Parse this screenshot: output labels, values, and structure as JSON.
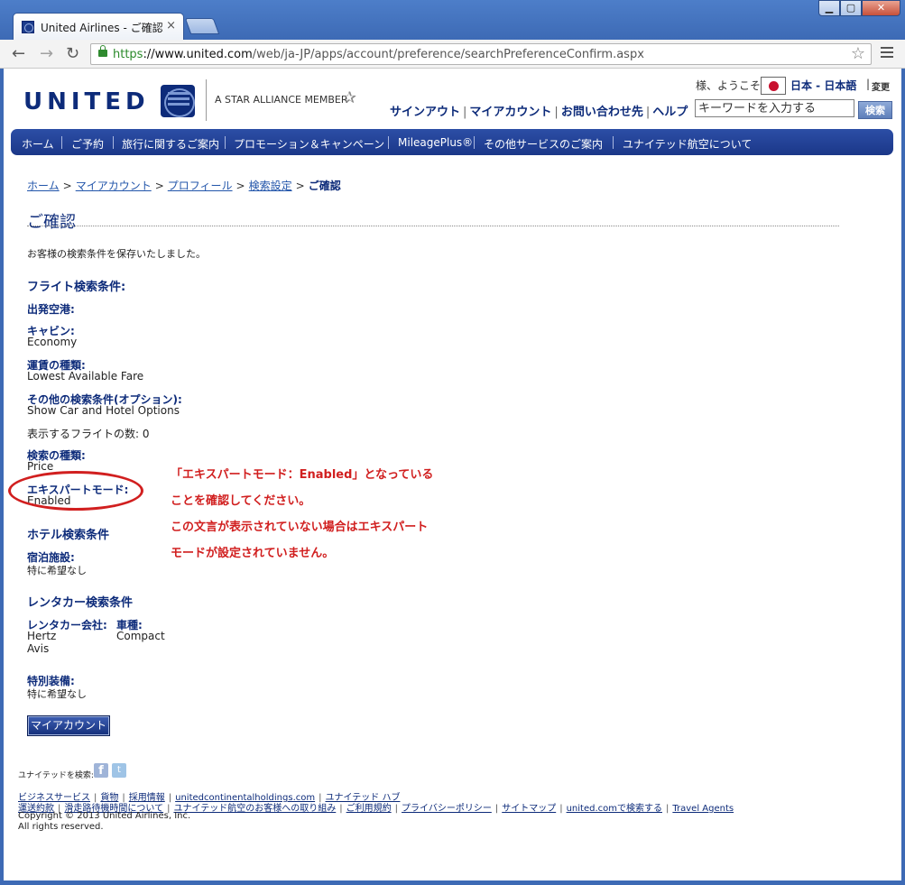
{
  "browser": {
    "tab_title": "United Airlines - ご確認",
    "url_https": "https",
    "url_host": "://www.united.com",
    "url_path": "/web/ja-JP/apps/account/preference/searchPreferenceConfirm.aspx"
  },
  "header": {
    "logo": "UNITED",
    "alliance": "A STAR ALLIANCE MEMBER",
    "greeting": "様、ようこそ",
    "language": "日本 - 日本語",
    "change": "変更",
    "links": [
      "サインアウト",
      "マイアカウント",
      "お問い合わせ先",
      "ヘルプ"
    ],
    "search_placeholder": "キーワードを入力する",
    "search_button": "検索"
  },
  "nav": [
    "ホーム",
    "ご予約",
    "旅行に関するご案内",
    "プロモーション＆キャンペーン",
    "MileagePlus®",
    "その他サービスのご案内",
    "ユナイテッド航空について"
  ],
  "breadcrumb": [
    "ホーム",
    "マイアカウント",
    "プロフィール",
    "検索設定",
    "ご確認"
  ],
  "page": {
    "title": "ご確認",
    "saved_message": "お客様の検索条件を保存いたしました。",
    "flight_section": "フライト検索条件:",
    "origin_label": "出発空港:",
    "cabin_label": "キャビン:",
    "cabin_value": "Economy",
    "fare_label": "運賃の種類:",
    "fare_value": "Lowest Available Fare",
    "options_label": "その他の検索条件(オプション):",
    "options_value": "Show Car and Hotel Options",
    "flights_count": "表示するフライトの数: 0",
    "search_type_label": "検索の種類:",
    "search_type_value": "Price",
    "expert_label": "エキスパートモード:",
    "expert_value": "Enabled",
    "hotel_section": "ホテル検索条件",
    "accommodation_label": "宿泊施設:",
    "accommodation_value": "特に希望なし",
    "car_section": "レンタカー検索条件",
    "car_company_label": "レンタカー会社:",
    "car_companies": [
      "Hertz",
      "Avis"
    ],
    "car_type_label": "車種:",
    "car_type_value": "Compact",
    "equipment_label": "特別装備:",
    "equipment_value": "特に希望なし",
    "myaccount_button": "マイアカウント"
  },
  "annotation": {
    "lines": [
      "「エキスパートモード：Enabled」となっている",
      "ことを確認してください。",
      "この文言が表示されていない場合はエキスパート",
      "モードが設定されていません。"
    ]
  },
  "footer": {
    "search_label": "ユナイテッドを検索:",
    "row1": [
      "ビジネスサービス",
      "貨物",
      "採用情報",
      "unitedcontinentalholdings.com",
      "ユナイテッド ハブ"
    ],
    "row2": [
      "運送約款",
      "滑走路待機時間について",
      "ユナイテッド航空のお客様への取り組み",
      "ご利用規約",
      "プライバシーポリシー",
      "サイトマップ",
      "united.comで検索する",
      "Travel Agents"
    ],
    "copyright": "Copyright © 2013 United Airlines, Inc.",
    "rights": "All rights reserved."
  },
  "colors": {
    "brand": "#0d2b7a",
    "annotation": "#d11f1f",
    "nav_bg": "#1b3788"
  }
}
